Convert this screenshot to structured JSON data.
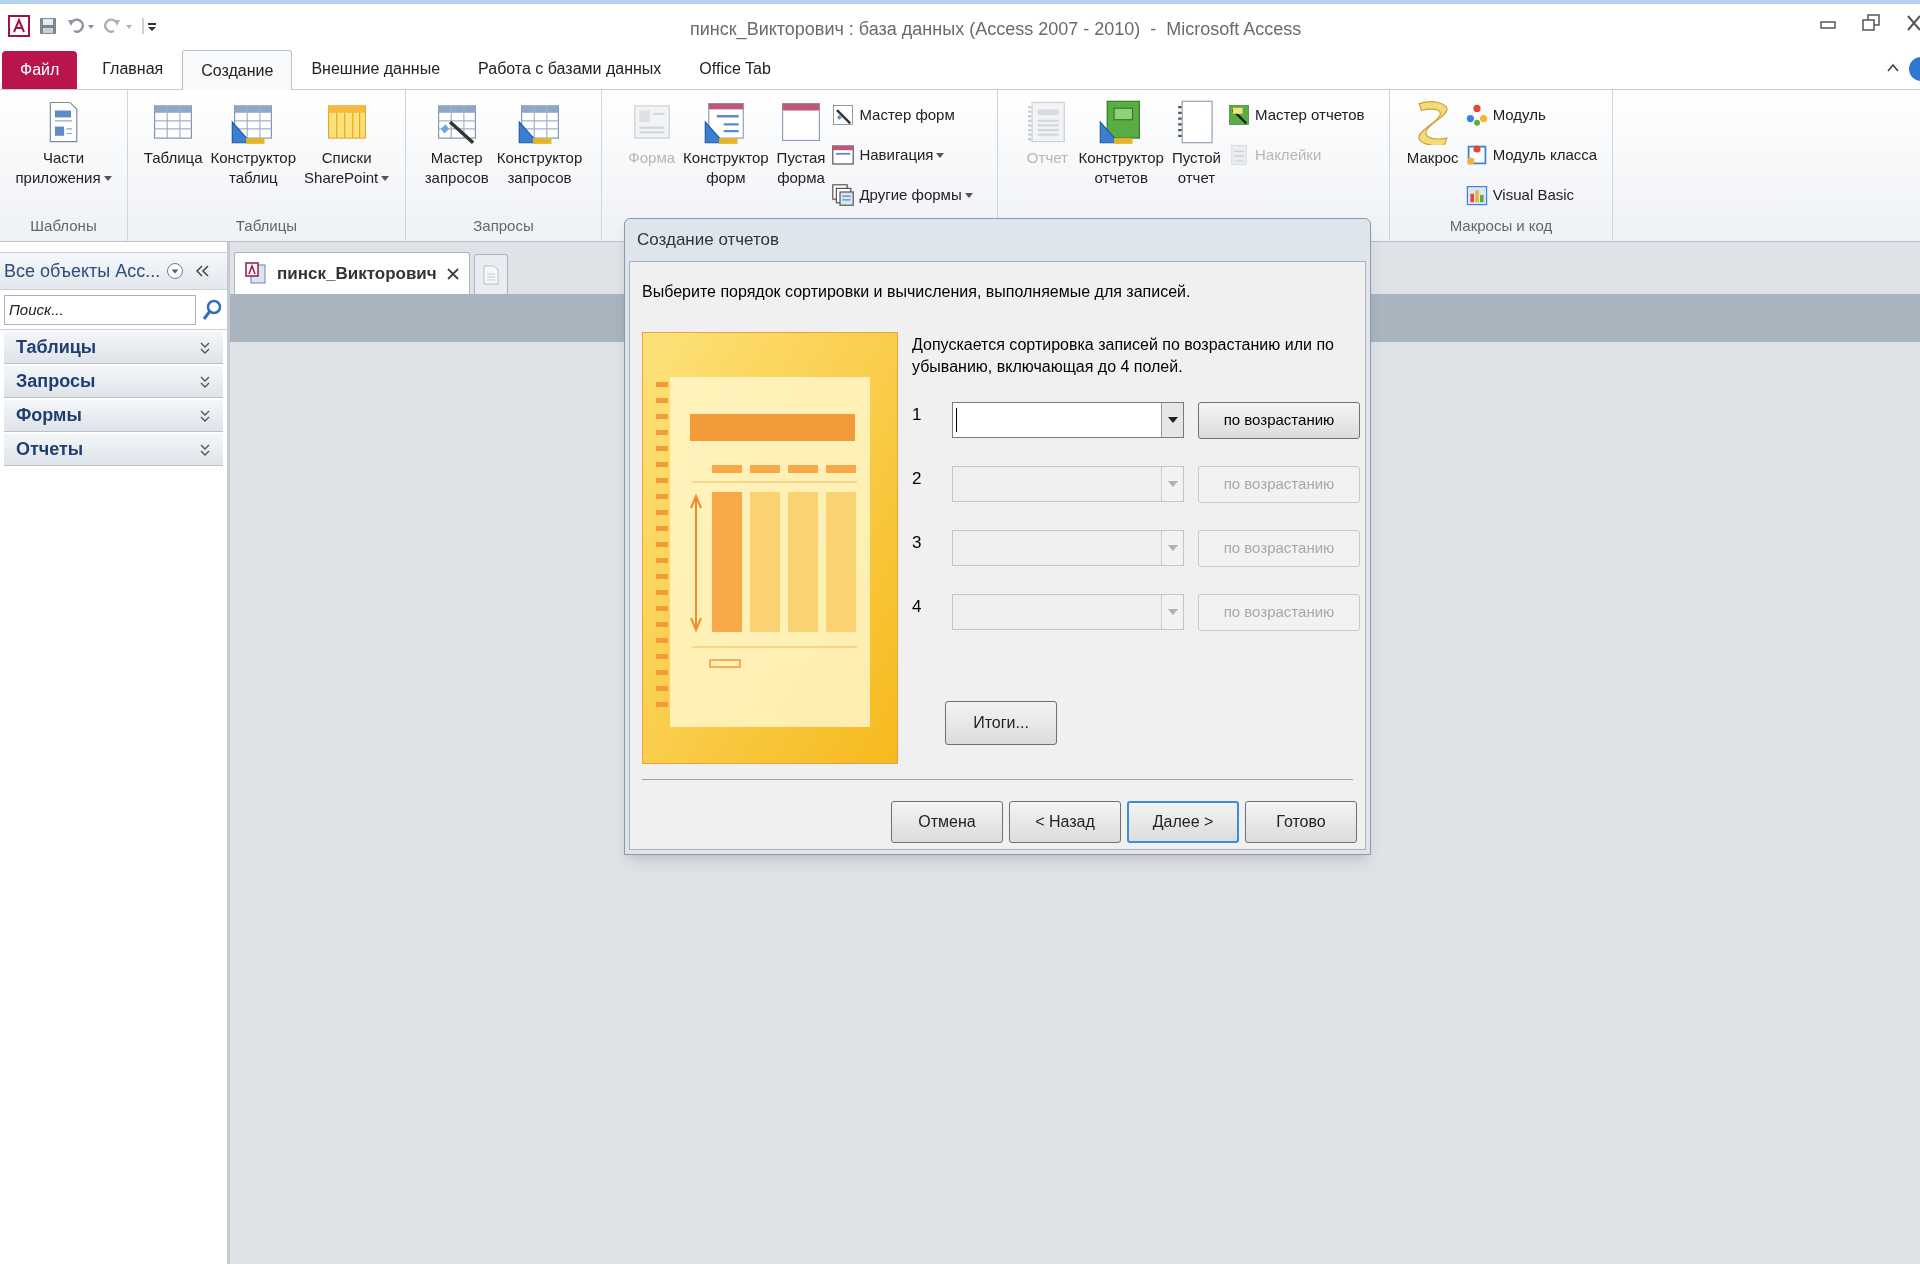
{
  "window": {
    "title": "пинск_Викторович : база данных (Access 2007 - 2010)  -  Microsoft Access"
  },
  "ribbon_tabs": [
    {
      "label": "Файл",
      "kind": "file",
      "selected": false
    },
    {
      "label": "Главная",
      "kind": "tab",
      "selected": false
    },
    {
      "label": "Создание",
      "kind": "tab",
      "selected": true
    },
    {
      "label": "Внешние данные",
      "kind": "tab",
      "selected": false
    },
    {
      "label": "Работа с базами данных",
      "kind": "tab",
      "selected": false
    },
    {
      "label": "Office Tab",
      "kind": "tab",
      "selected": false
    }
  ],
  "ribbon_groups": [
    {
      "label": "Шаблоны",
      "items": [
        {
          "kind": "large",
          "label": "Части\nприложения",
          "dropdown": true,
          "disabled": false
        }
      ]
    },
    {
      "label": "Таблицы",
      "items": [
        {
          "kind": "large",
          "label": "Таблица",
          "dropdown": false,
          "disabled": false
        },
        {
          "kind": "large",
          "label": "Конструктор\nтаблиц",
          "dropdown": false,
          "disabled": false
        },
        {
          "kind": "large",
          "label": "Списки\nSharePoint",
          "dropdown": true,
          "disabled": false
        }
      ]
    },
    {
      "label": "Запросы",
      "items": [
        {
          "kind": "large",
          "label": "Мастер\nзапросов",
          "dropdown": false,
          "disabled": false
        },
        {
          "kind": "large",
          "label": "Конструктор\nзапросов",
          "dropdown": false,
          "disabled": false
        }
      ]
    },
    {
      "items": [
        {
          "kind": "large",
          "label": "Форма",
          "dropdown": false,
          "disabled": true
        },
        {
          "kind": "large",
          "label": "Конструктор\nформ",
          "dropdown": false,
          "disabled": false
        },
        {
          "kind": "large",
          "label": "Пустая\nформа",
          "dropdown": false,
          "disabled": false
        },
        {
          "kind": "small",
          "label": "Мастер форм",
          "dropdown": false,
          "disabled": false
        },
        {
          "kind": "small",
          "label": "Навигация",
          "dropdown": true,
          "disabled": false
        },
        {
          "kind": "small",
          "label": "Другие формы",
          "dropdown": true,
          "disabled": false
        }
      ]
    },
    {
      "items": [
        {
          "kind": "large",
          "label": "Отчет",
          "dropdown": false,
          "disabled": true
        },
        {
          "kind": "large",
          "label": "Конструктор\nотчетов",
          "dropdown": false,
          "disabled": false
        },
        {
          "kind": "large",
          "label": "Пустой\nотчет",
          "dropdown": false,
          "disabled": false
        },
        {
          "kind": "small",
          "label": "Мастер отчетов",
          "dropdown": false,
          "disabled": false
        },
        {
          "kind": "small",
          "label": "Наклейки",
          "dropdown": false,
          "disabled": true
        }
      ]
    },
    {
      "label": "Макросы и код",
      "items": [
        {
          "kind": "large",
          "label": "Макрос",
          "dropdown": false,
          "disabled": false
        },
        {
          "kind": "small",
          "label": "Модуль",
          "dropdown": false,
          "disabled": false
        },
        {
          "kind": "small",
          "label": "Модуль класса",
          "dropdown": false,
          "disabled": false
        },
        {
          "kind": "small",
          "label": "Visual Basic",
          "dropdown": false,
          "disabled": false
        }
      ]
    }
  ],
  "nav_pane": {
    "title": "Все объекты Acc...",
    "search": {
      "placeholder": "Поиск..."
    },
    "groups": [
      {
        "label": "Таблицы",
        "expanded": false
      },
      {
        "label": "Запросы",
        "expanded": false
      },
      {
        "label": "Формы",
        "expanded": false
      },
      {
        "label": "Отчеты",
        "expanded": false
      }
    ]
  },
  "document_tabs": [
    {
      "label": "пинск_Викторович",
      "selected": true
    }
  ],
  "dialog": {
    "title": "Создание отчетов",
    "instruction": "Выберите порядок сортировки и вычисления, выполняемые для записей.",
    "description": "Допускается сортировка записей по возрастанию или по убыванию, включающая до 4 полей.",
    "sort_rows": [
      {
        "number": "1",
        "order": "по возрастанию",
        "disabled": false,
        "focused": true
      },
      {
        "number": "2",
        "order": "по возрастанию",
        "disabled": true,
        "focused": false
      },
      {
        "number": "3",
        "order": "по возрастанию",
        "disabled": true,
        "focused": false
      },
      {
        "number": "4",
        "order": "по возрастанию",
        "disabled": true,
        "focused": false
      }
    ],
    "summary_button": "Итоги...",
    "buttons": [
      {
        "label": "Отмена",
        "default": false
      },
      {
        "label": "< Назад",
        "default": false
      },
      {
        "label": "Далее >",
        "default": true
      },
      {
        "label": "Готово",
        "default": false
      }
    ]
  }
}
